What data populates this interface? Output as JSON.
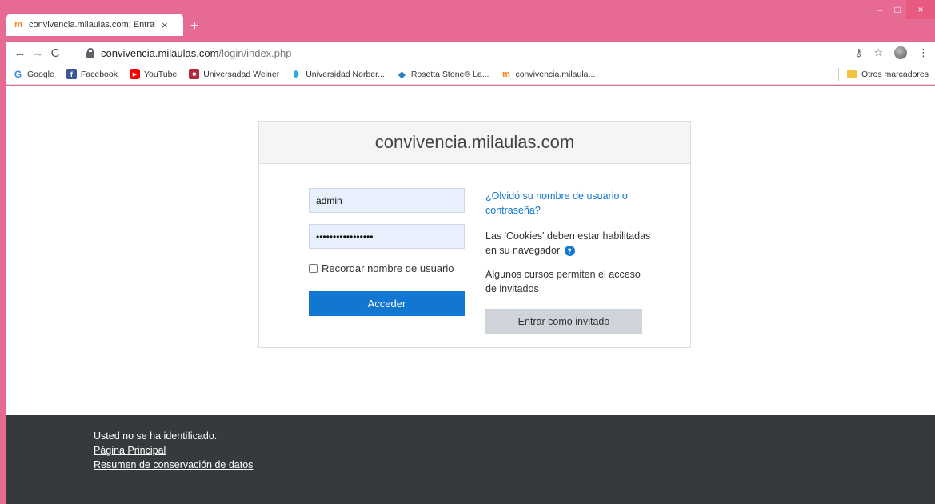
{
  "browser": {
    "tab_title": "convivencia.milaulas.com: Entrar",
    "tab_close": "×",
    "new_tab": "+",
    "url_host": "convivencia.milaulas.com",
    "url_path": "/login/index.php",
    "window_controls": {
      "minimize": "–",
      "maximize": "□",
      "close": "×"
    }
  },
  "bookmarks": {
    "items": [
      {
        "label": "Google",
        "icon": "google-icon",
        "color": "#4285f4"
      },
      {
        "label": "Facebook",
        "icon": "facebook-icon",
        "color": "#3b5998"
      },
      {
        "label": "YouTube",
        "icon": "youtube-icon",
        "color": "#ff0000"
      },
      {
        "label": "Universadad Weiner",
        "icon": "weiner-icon",
        "color": "#b22b3a"
      },
      {
        "label": "Universidad Norber...",
        "icon": "norbert-icon",
        "color": "#2aa8e0"
      },
      {
        "label": "Rosetta Stone® La...",
        "icon": "rosetta-icon",
        "color": "#2b7fc2"
      },
      {
        "label": "convivencia.milaula...",
        "icon": "moodle-icon",
        "color": "#f98012"
      }
    ],
    "other": "Otros marcadores"
  },
  "login": {
    "site_name": "convivencia.milaulas.com",
    "username_value": "admin",
    "password_value": "•••••••••••••••••",
    "remember_label": "Recordar nombre de usuario",
    "submit_label": "Acceder",
    "forgot_link": "¿Olvidó su nombre de usuario o contraseña?",
    "cookies_info": "Las 'Cookies' deben estar habilitadas en su navegador",
    "guest_info": "Algunos cursos permiten el acceso de invitados",
    "guest_button": "Entrar como invitado"
  },
  "footer": {
    "status": "Usted no se ha identificado.",
    "home_link": "Página Principal",
    "privacy_link": "Resumen de conservación de datos"
  },
  "colors": {
    "window_frame": "#e76a93",
    "accent": "#1177d1",
    "footer_bg": "#373a3c"
  }
}
